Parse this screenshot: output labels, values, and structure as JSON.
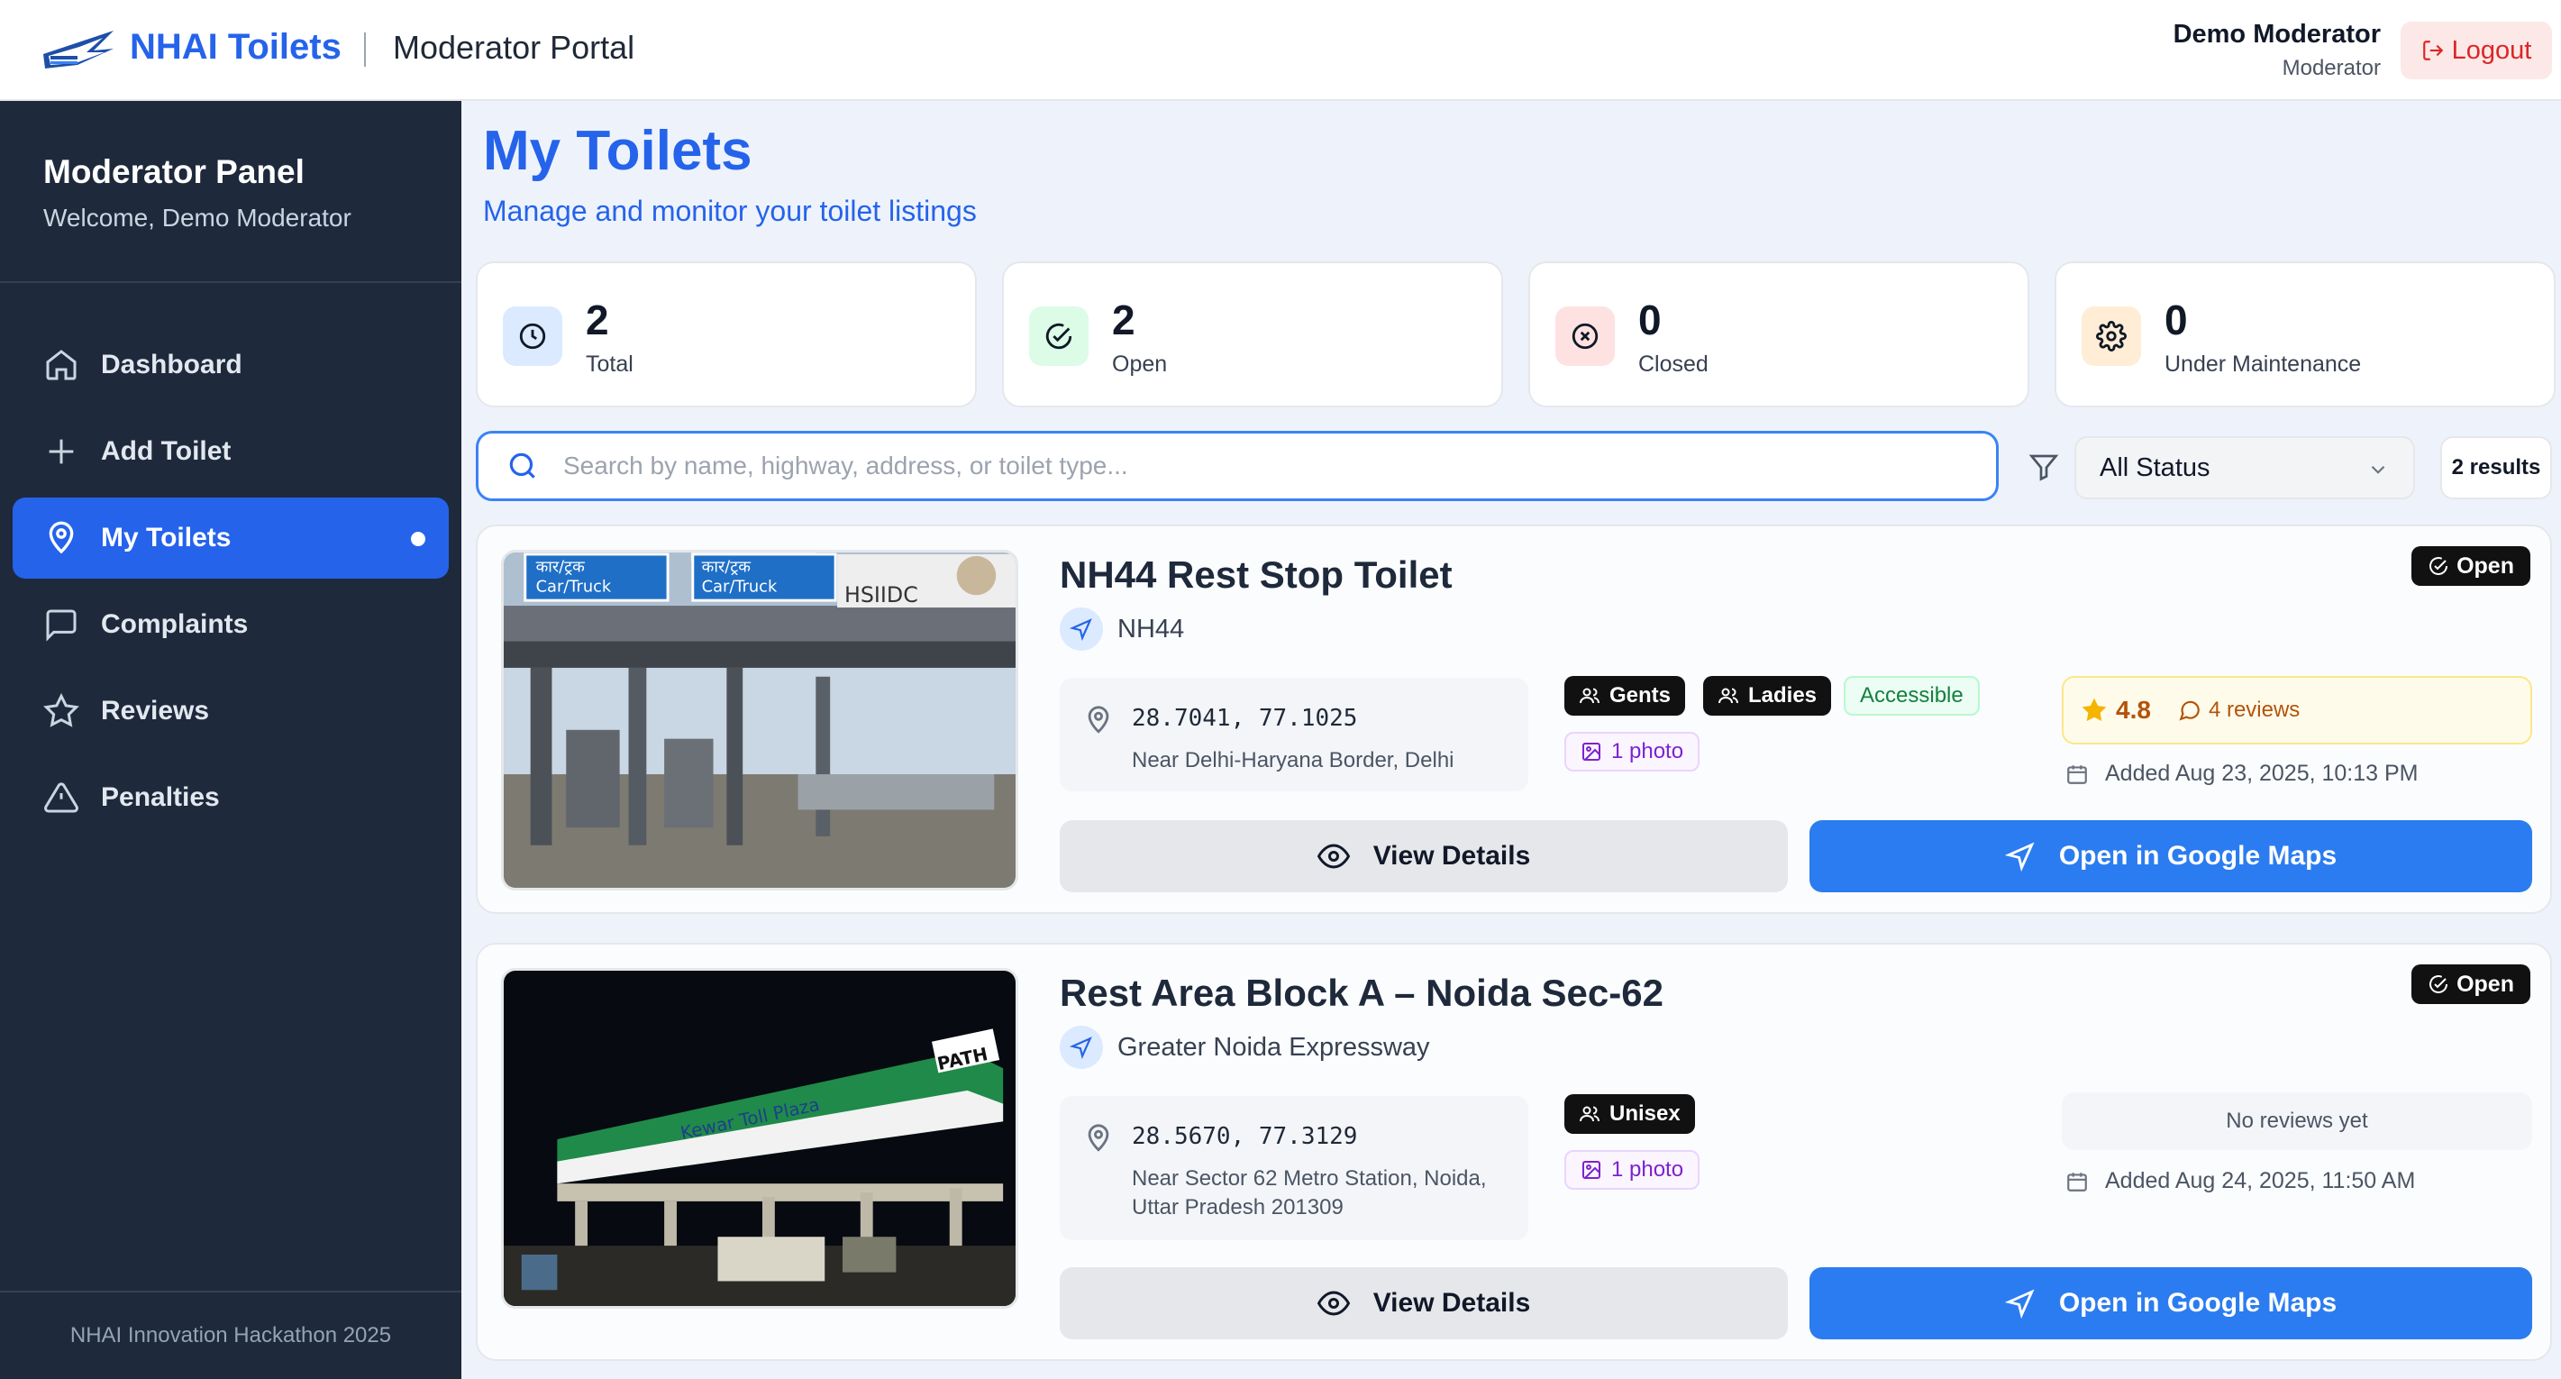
{
  "header": {
    "brand": "NHAI Toilets",
    "portal": "Moderator Portal",
    "user_name": "Demo Moderator",
    "user_role": "Moderator",
    "logout_label": "Logout"
  },
  "sidebar": {
    "title": "Moderator Panel",
    "welcome": "Welcome, Demo Moderator",
    "items": [
      {
        "label": "Dashboard",
        "icon": "home-icon"
      },
      {
        "label": "Add Toilet",
        "icon": "plus-icon"
      },
      {
        "label": "My Toilets",
        "icon": "map-pin-icon",
        "active": true
      },
      {
        "label": "Complaints",
        "icon": "message-square-icon"
      },
      {
        "label": "Reviews",
        "icon": "star-icon"
      },
      {
        "label": "Penalties",
        "icon": "alert-triangle-icon"
      }
    ],
    "footer": "NHAI Innovation Hackathon 2025"
  },
  "main": {
    "title": "My Toilets",
    "subtitle": "Manage and monitor your toilet listings"
  },
  "stats": [
    {
      "value": "2",
      "label": "Total",
      "icon": "clock-icon",
      "color": "#dbeafe"
    },
    {
      "value": "2",
      "label": "Open",
      "icon": "check-circle-icon",
      "color": "#dcfce7"
    },
    {
      "value": "0",
      "label": "Closed",
      "icon": "x-circle-icon",
      "color": "#fee2e2"
    },
    {
      "value": "0",
      "label": "Under Maintenance",
      "icon": "gear-icon",
      "color": "#ffedd5"
    }
  ],
  "search": {
    "placeholder": "Search by name, highway, address, or toilet type...",
    "status_filter": "All Status",
    "results": "2 results"
  },
  "toilets": [
    {
      "name": "NH44 Rest Stop Toilet",
      "highway": "NH44",
      "status": "Open",
      "coords": "28.7041, 77.1025",
      "address": "Near Delhi-Haryana Border, Delhi",
      "tags": [
        "Gents",
        "Ladies"
      ],
      "accessible": "Accessible",
      "photos": "1 photo",
      "rating": "4.8",
      "reviews": "4 reviews",
      "added": "Added Aug 23, 2025, 10:13 PM",
      "photo_signs": [
        "कार/ट्रक",
        "Car/Truck",
        "कार/ट्रक",
        "Car/Truck",
        "HSIIDC"
      ]
    },
    {
      "name": "Rest Area Block A – Noida Sec-62",
      "highway": "Greater Noida Expressway",
      "status": "Open",
      "coords": "28.5670, 77.3129",
      "address": "Near Sector 62 Metro Station, Noida, Uttar Pradesh 201309",
      "tags": [
        "Unisex"
      ],
      "photos": "1 photo",
      "no_reviews": "No reviews yet",
      "added": "Added Aug 24, 2025, 11:50 AM",
      "photo_signs": [
        "Kewar Toll Plaza",
        "PATH"
      ]
    }
  ],
  "buttons": {
    "view_details": "View Details",
    "open_maps": "Open in Google Maps"
  },
  "colors": {
    "accent": "#2563eb",
    "sidebar": "#1e293b",
    "maps_button": "#2b7cf0"
  }
}
